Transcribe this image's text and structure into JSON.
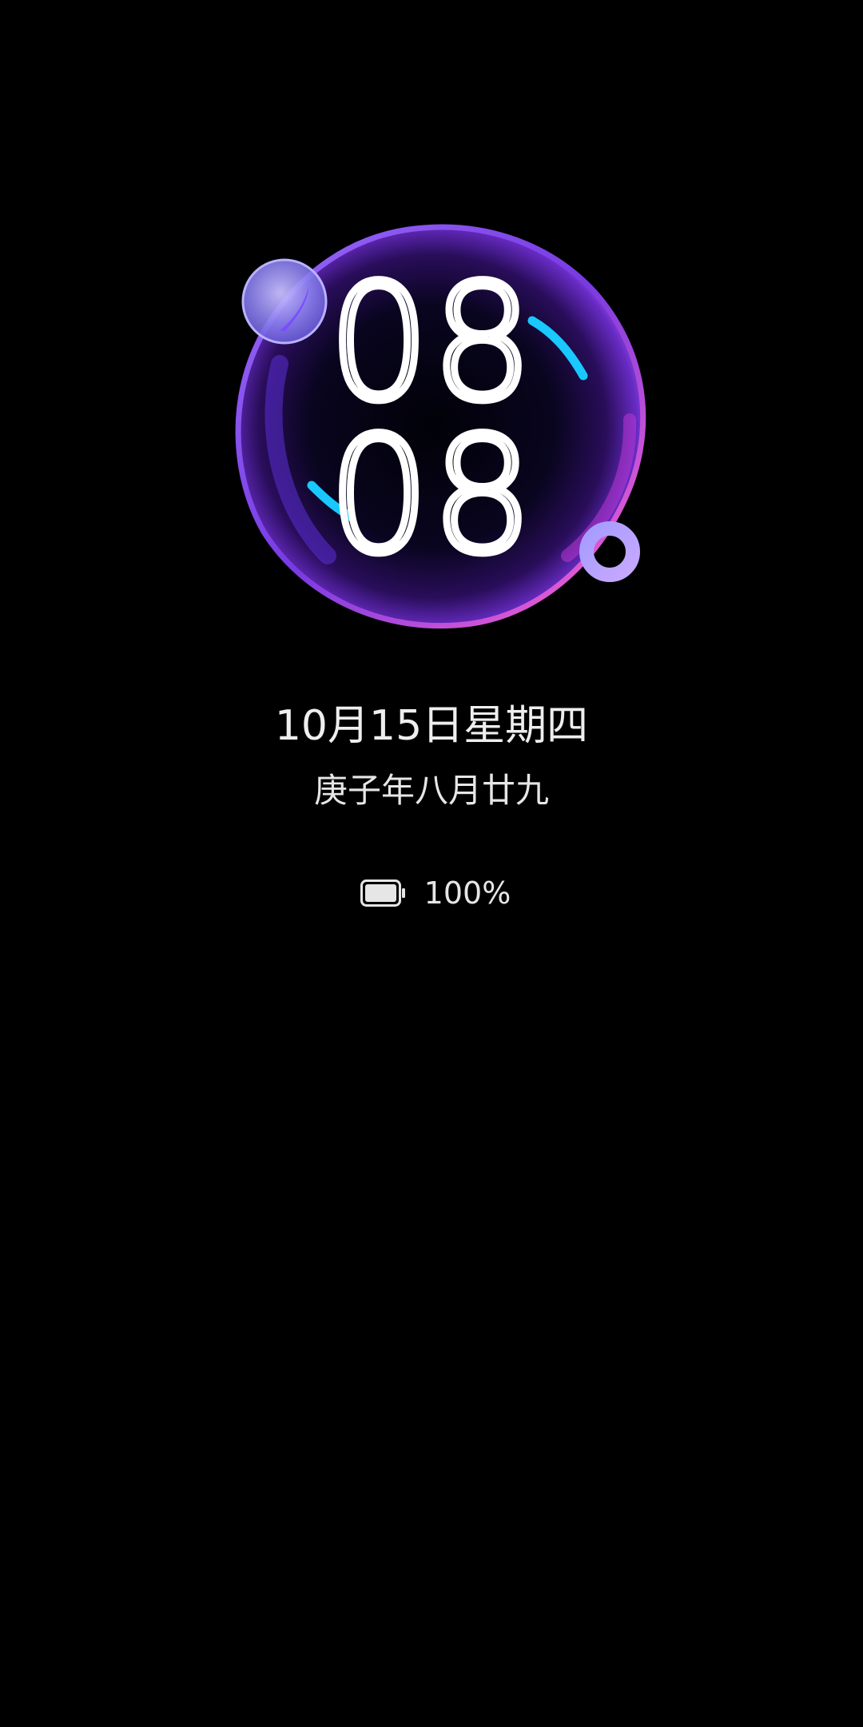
{
  "lockscreen": {
    "time": {
      "hours": "08",
      "minutes": "08"
    },
    "date": "10月15日星期四",
    "lunar_date": "庚子年八月廿九",
    "battery": {
      "icon": "battery-icon",
      "level_percent": 100,
      "label": "100%"
    },
    "wallpaper": {
      "icon": "bubble-clock-art",
      "colors": {
        "background": "#000000",
        "bubble_purple": "#8a3cf0",
        "bubble_magenta": "#d24fe0",
        "highlight_cyan": "#18c8ff"
      }
    }
  }
}
